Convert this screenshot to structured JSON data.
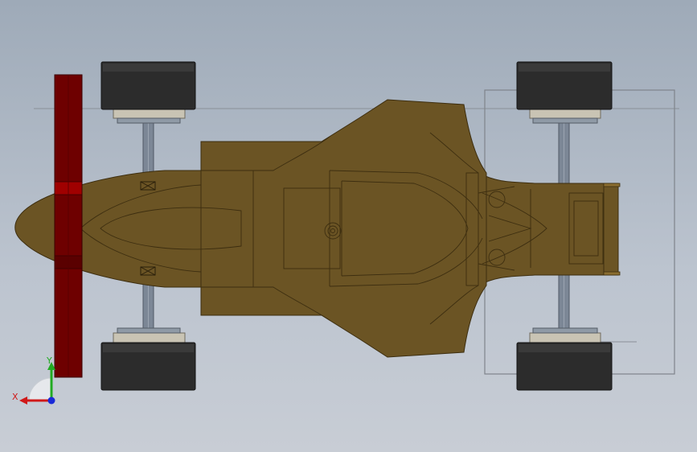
{
  "viewport": {
    "background_top": "#9eaab8",
    "background_bottom": "#c8cdd5"
  },
  "model": {
    "body_color": "#6b5424",
    "body_edge_color": "#3d2e10",
    "front_wing_color": "#6e0000",
    "tire_color": "#2c2c2c",
    "axle_color": "#7c8796",
    "hub_color": "#c9c4b4"
  },
  "triad": {
    "x_label": "X",
    "y_label": "Y",
    "x_color": "#d01818",
    "y_color": "#22aa22",
    "z_color": "#1a2ad8"
  }
}
